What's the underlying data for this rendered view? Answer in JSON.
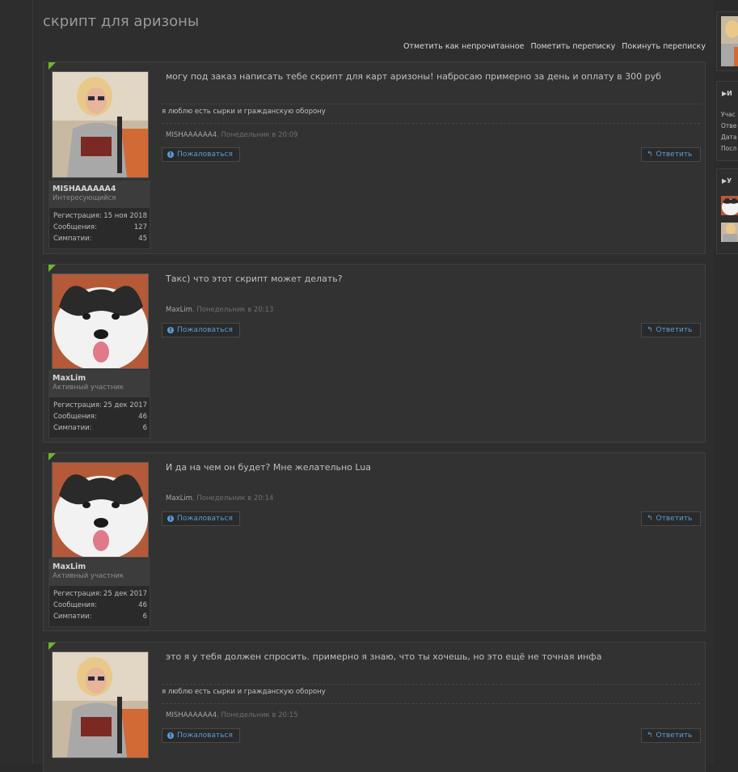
{
  "thread_title": "скрипт для аризоны",
  "actions": [
    "Отметить как непрочитанное",
    "Пометить переписку",
    "Покинуть переписку"
  ],
  "stat_labels": {
    "reg": "Регистрация:",
    "msgs": "Сообщения:",
    "likes": "Симпатии:"
  },
  "buttons": {
    "report": "Пожаловаться",
    "reply": "Ответить"
  },
  "posts": [
    {
      "user": "MISHAAAAAA4",
      "user_title": "Интересующийся",
      "reg": "15 ноя 2018",
      "msgs": "127",
      "likes": "45",
      "text": "могу под заказ написать тебе скрипт для карт аризоны! набросаю примерно за день и оплату в 300 руб",
      "signature": "я люблю есть сырки и гражданскую оборону",
      "author": "MISHAAAAAA4",
      "date": "Понедельник в 20:09"
    },
    {
      "user": "MaxLim",
      "user_title": "Активный участник",
      "reg": "25 дек 2017",
      "msgs": "46",
      "likes": "6",
      "text": "Такс) что этот скрипт может делать?",
      "author": "MaxLim",
      "date": "Понедельник в 20:13"
    },
    {
      "user": "MaxLim",
      "user_title": "Активный участник",
      "reg": "25 дек 2017",
      "msgs": "46",
      "likes": "6",
      "text": "И да на чем он будет? Мне желательно Lua",
      "author": "MaxLim",
      "date": "Понедельник в 20:14"
    },
    {
      "text": "это я у тебя должен спросить. примерно я знаю, что ты хочешь, но это ещё не точная инфа",
      "signature": "я люблю есть сырки и гражданскую оборону",
      "author": "MISHAAAAAA4",
      "date": "Понедельник в 20:15"
    }
  ],
  "sidebar": {
    "block1_header": "И",
    "block1_lines": [
      "Учас",
      "Отве",
      "Дата",
      "Посл"
    ],
    "block2_header": "У"
  },
  "colors": {
    "accent": "#5b9bd5",
    "corner": "#6fb52c",
    "background": "#2b2b2b"
  }
}
